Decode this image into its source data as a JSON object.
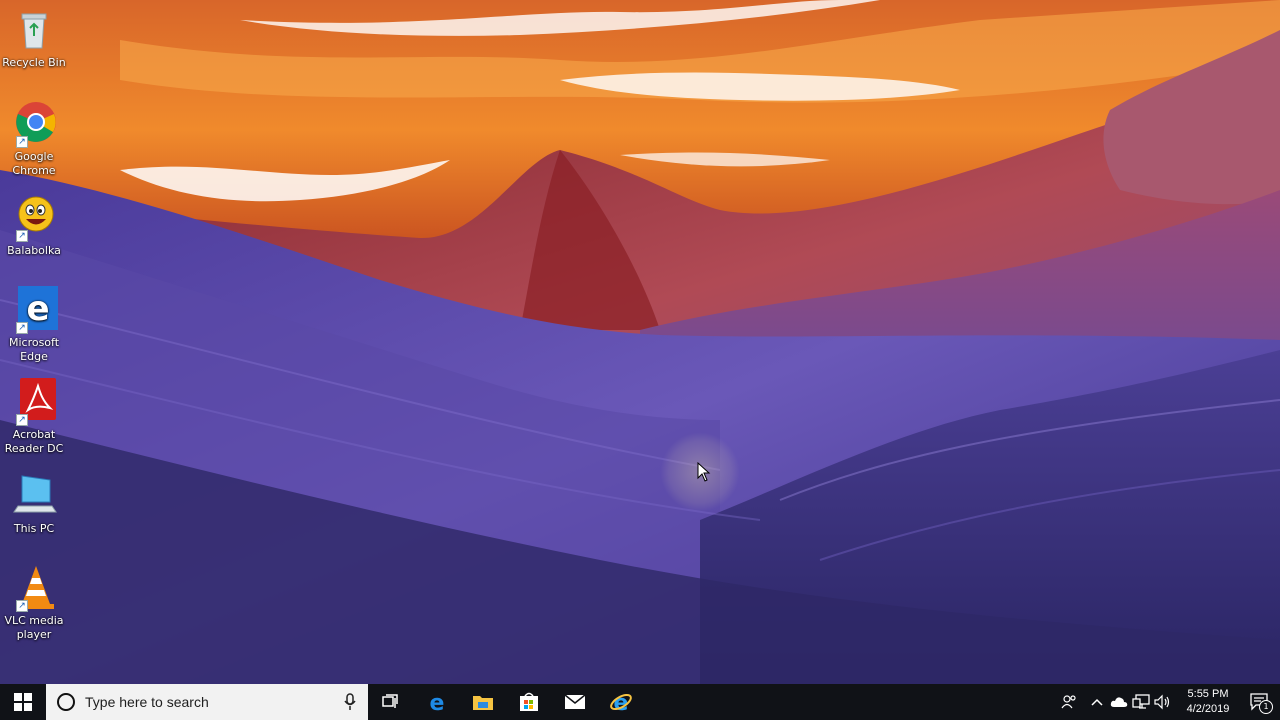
{
  "desktop": {
    "icons": [
      {
        "label": "Recycle Bin",
        "icon": "recycle-bin-icon"
      },
      {
        "label": "Google Chrome",
        "icon": "chrome-icon"
      },
      {
        "label": "Balabolka",
        "icon": "balabolka-icon"
      },
      {
        "label": "Microsoft Edge",
        "icon": "edge-icon"
      },
      {
        "label": "Acrobat Reader DC",
        "icon": "acrobat-icon"
      },
      {
        "label": "This PC",
        "icon": "this-pc-icon"
      },
      {
        "label": "VLC media player",
        "icon": "vlc-icon"
      }
    ]
  },
  "taskbar": {
    "search_placeholder": "Type here to search",
    "pinned": [
      "task-view-icon",
      "edge-icon",
      "file-explorer-icon",
      "store-icon",
      "mail-icon",
      "internet-explorer-icon"
    ],
    "clock": {
      "time": "5:55 PM",
      "date": "4/2/2019"
    },
    "notification_count": "1"
  },
  "colors": {
    "taskbar": "#101217",
    "search_box": "#f2f2f2",
    "accent_blue": "#1e73d8"
  }
}
